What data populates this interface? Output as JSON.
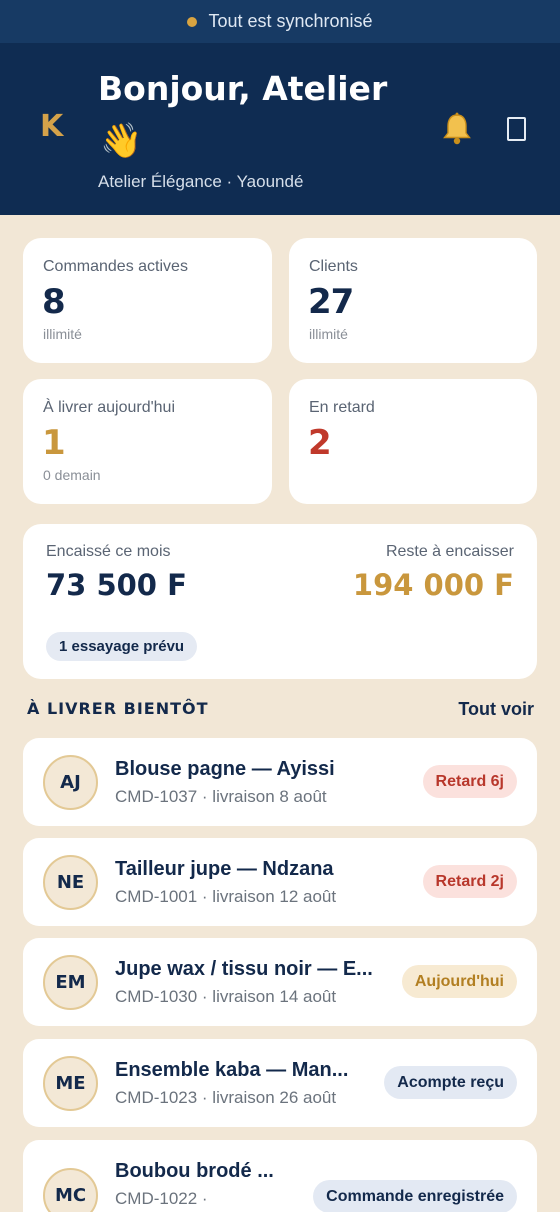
{
  "sync": {
    "text": "Tout est synchronisé"
  },
  "header": {
    "logo": "K",
    "greeting": "Bonjour, Atelier",
    "wave": "👋",
    "subtitle": "Atelier Élégance · Yaoundé",
    "icons": [
      "bell-icon",
      "device-icon"
    ]
  },
  "stats": [
    {
      "label": "Commandes actives",
      "value": "8",
      "sub": "illimité",
      "color": "#13294b"
    },
    {
      "label": "Clients",
      "value": "27",
      "sub": "illimité",
      "color": "#13294b"
    },
    {
      "label": "À livrer aujourd'hui",
      "value": "1",
      "sub": "0 demain",
      "color": "#c9973d"
    },
    {
      "label": "En retard",
      "value": "2",
      "sub": "",
      "color": "#c0392b"
    }
  ],
  "money": {
    "collected_label": "Encaissé ce mois",
    "collected_value": "73 500 F",
    "remaining_label": "Reste à encaisser",
    "remaining_value": "194 000 F",
    "fitting_pill": "1 essayage prévu"
  },
  "section": {
    "title": "À LIVRER BIENTÔT",
    "see_all": "Tout voir"
  },
  "orders": [
    {
      "initials": "AJ",
      "title": "Blouse pagne — Ayissi",
      "sub": "CMD-1037 · livraison 8 août",
      "badge": "Retard 6j",
      "badge_type": "late"
    },
    {
      "initials": "NE",
      "title": "Tailleur jupe — Ndzana",
      "sub": "CMD-1001 · livraison 12 août",
      "badge": "Retard 2j",
      "badge_type": "late"
    },
    {
      "initials": "EM",
      "title": "Jupe wax / tissu noir — E...",
      "sub": "CMD-1030 · livraison 14 août",
      "badge": "Aujourd'hui",
      "badge_type": "today"
    },
    {
      "initials": "ME",
      "title": "Ensemble kaba — Man...",
      "sub": "CMD-1023 · livraison 26 août",
      "badge": "Acompte reçu",
      "badge_type": "info"
    },
    {
      "initials": "MC",
      "title": "Boubou brodé ...",
      "sub": "CMD-1022 ·",
      "badge": "Commande enregistrée",
      "badge_type": "info"
    }
  ],
  "colors": {
    "navy": "#0f2c52",
    "gold": "#c9973d",
    "late": "#c0392b",
    "background": "#f2e7d6"
  }
}
